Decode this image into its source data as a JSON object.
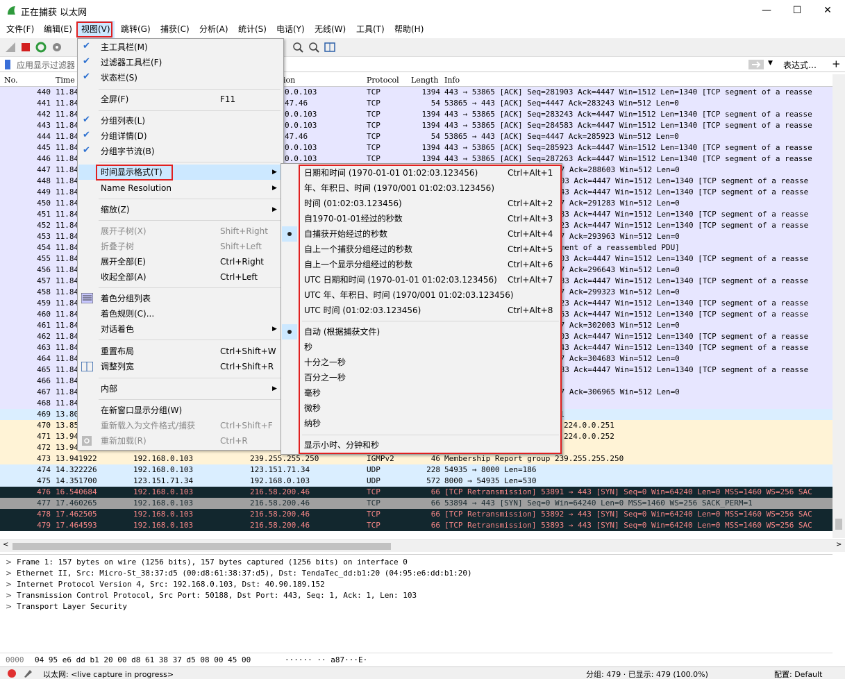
{
  "window": {
    "title": "正在捕获 以太网",
    "min": "—",
    "max": "☐",
    "close": "✕"
  },
  "menubar": [
    "文件(F)",
    "编辑(E)",
    "视图(V)",
    "跳转(G)",
    "捕获(C)",
    "分析(A)",
    "统计(S)",
    "电话(Y)",
    "无线(W)",
    "工具(T)",
    "帮助(H)"
  ],
  "filter": {
    "placeholder": "应用显示过滤器 …",
    "expr_label": "表达式…",
    "plus": "+"
  },
  "columns": {
    "no": "No.",
    "time": "Time",
    "dest_partial": "ion",
    "protocol": "Protocol",
    "length": "Length",
    "info": "Info"
  },
  "rows_top": [
    {
      "no": "440",
      "time": "11.84",
      "dst": "0.0.103",
      "proto": "TCP",
      "len": "1394",
      "info": "443 → 53865 [ACK] Seq=281903 Ack=4447 Win=1512 Len=1340 [TCP segment of a reasse"
    },
    {
      "no": "441",
      "time": "11.84",
      "dst": "47.46",
      "proto": "TCP",
      "len": "54",
      "info": "53865 → 443 [ACK] Seq=4447 Ack=283243 Win=512 Len=0"
    },
    {
      "no": "442",
      "time": "11.84",
      "dst": "0.0.103",
      "proto": "TCP",
      "len": "1394",
      "info": "443 → 53865 [ACK] Seq=283243 Ack=4447 Win=1512 Len=1340 [TCP segment of a reasse"
    },
    {
      "no": "443",
      "time": "11.84",
      "dst": "0.0.103",
      "proto": "TCP",
      "len": "1394",
      "info": "443 → 53865 [ACK] Seq=284583 Ack=4447 Win=1512 Len=1340 [TCP segment of a reasse"
    },
    {
      "no": "444",
      "time": "11.84",
      "dst": "47.46",
      "proto": "TCP",
      "len": "54",
      "info": "53865 → 443 [ACK] Seq=4447 Ack=285923 Win=512 Len=0"
    },
    {
      "no": "445",
      "time": "11.84",
      "dst": "0.0.103",
      "proto": "TCP",
      "len": "1394",
      "info": "443 → 53865 [ACK] Seq=285923 Ack=4447 Win=1512 Len=1340 [TCP segment of a reasse"
    },
    {
      "no": "446",
      "time": "11.84",
      "dst": "0.0.103",
      "proto": "TCP",
      "len": "1394",
      "info": "443 → 53865 [ACK] Seq=287263 Ack=4447 Win=1512 Len=1340 [TCP segment of a reasse"
    }
  ],
  "rows_mid_right": [
    "47 Ack=288603 Win=512 Len=0",
    "603 Ack=4447 Win=1512 Len=1340 [TCP segment of a reasse",
    "943 Ack=4447 Win=1512 Len=1340 [TCP segment of a reasse",
    "47 Ack=291283 Win=512 Len=0",
    "283 Ack=4447 Win=1512 Len=1340 [TCP segment of a reasse",
    "623 Ack=4447 Win=1512 Len=1340 [TCP segment of a reasse",
    "47 Ack=293963 Win=512 Len=0",
    "gment of a reassembled PDU]",
    "303 Ack=4447 Win=1512 Len=1340 [TCP segment of a reasse",
    "47 Ack=296643 Win=512 Len=0",
    "983 Ack=4447 Win=1512 Len=1340 [TCP segment of a reasse",
    "47 Ack=299323 Win=512 Len=0",
    "323 Ack=4447 Win=1512 Len=1340 [TCP segment of a reasse",
    "663 Ack=4447 Win=1512 Len=1340 [TCP segment of a reasse",
    "47 Ack=302003 Win=512 Len=0",
    "003 Ack=4447 Win=1512 Len=1340 [TCP segment of a reasse",
    "343 Ack=4447 Win=1512 Len=1340 [TCP segment of a reasse",
    "47 Ack=304683 Win=512 Len=0",
    "683 Ack=4447 Win=1512 Len=1340 [TCP segment of a reasse",
    "",
    "47 Ack=306965 Win=512 Len=0",
    "",
    "1",
    "224.0.0.251",
    "224.0.0.252"
  ],
  "rows_mid_left": [
    {
      "no": "447",
      "time": "11.84"
    },
    {
      "no": "448",
      "time": "11.84"
    },
    {
      "no": "449",
      "time": "11.84"
    },
    {
      "no": "450",
      "time": "11.84"
    },
    {
      "no": "451",
      "time": "11.84"
    },
    {
      "no": "452",
      "time": "11.84"
    },
    {
      "no": "453",
      "time": "11.84"
    },
    {
      "no": "454",
      "time": "11.84"
    },
    {
      "no": "455",
      "time": "11.84"
    },
    {
      "no": "456",
      "time": "11.84"
    },
    {
      "no": "457",
      "time": "11.84"
    },
    {
      "no": "458",
      "time": "11.84"
    },
    {
      "no": "459",
      "time": "11.84"
    },
    {
      "no": "460",
      "time": "11.84"
    },
    {
      "no": "461",
      "time": "11.84"
    },
    {
      "no": "462",
      "time": "11.84"
    },
    {
      "no": "463",
      "time": "11.84"
    },
    {
      "no": "464",
      "time": "11.84"
    },
    {
      "no": "465",
      "time": "11.84"
    },
    {
      "no": "466",
      "time": "11.84"
    },
    {
      "no": "467",
      "time": "11.84"
    },
    {
      "no": "468",
      "time": "11.84"
    },
    {
      "no": "469",
      "time": "13.80"
    },
    {
      "no": "470",
      "time": "13.85"
    },
    {
      "no": "471",
      "time": "13.94"
    },
    {
      "no": "472",
      "time": "13.94"
    }
  ],
  "rows_bottom": [
    {
      "no": "473",
      "time": "13.941922",
      "src": "192.168.0.103",
      "dst": "239.255.255.250",
      "proto": "IGMPv2",
      "len": "46",
      "info": "Membership Report group 239.255.255.250"
    },
    {
      "no": "474",
      "time": "14.322226",
      "src": "192.168.0.103",
      "dst": "123.151.71.34",
      "proto": "UDP",
      "len": "228",
      "info": "54935 → 8000 Len=186"
    },
    {
      "no": "475",
      "time": "14.351700",
      "src": "123.151.71.34",
      "dst": "192.168.0.103",
      "proto": "UDP",
      "len": "572",
      "info": "8000 → 54935 Len=530"
    },
    {
      "no": "476",
      "time": "16.540684",
      "src": "192.168.0.103",
      "dst": "216.58.200.46",
      "proto": "TCP",
      "len": "66",
      "info": "[TCP Retransmission] 53891 → 443 [SYN] Seq=0 Win=64240 Len=0 MSS=1460 WS=256 SAC"
    },
    {
      "no": "477",
      "time": "17.460265",
      "src": "192.168.0.103",
      "dst": "216.58.200.46",
      "proto": "TCP",
      "len": "66",
      "info": "53894 → 443 [SYN] Seq=0 Win=64240 Len=0 MSS=1460 WS=256 SACK_PERM=1"
    },
    {
      "no": "478",
      "time": "17.462505",
      "src": "192.168.0.103",
      "dst": "216.58.200.46",
      "proto": "TCP",
      "len": "66",
      "info": "[TCP Retransmission] 53892 → 443 [SYN] Seq=0 Win=64240 Len=0 MSS=1460 WS=256 SAC"
    },
    {
      "no": "479",
      "time": "17.464593",
      "src": "192.168.0.103",
      "dst": "216.58.200.46",
      "proto": "TCP",
      "len": "66",
      "info": "[TCP Retransmission] 53893 → 443 [SYN] Seq=0 Win=64240 Len=0 MSS=1460 WS=256 SAC"
    }
  ],
  "colors": {
    "tcp_row": "#e7e6ff",
    "udp_row": "#daeeff",
    "igmp_row": "#fff3d6",
    "bad_row_bg": "#12272e",
    "bad_row_fg": "#f78787",
    "gray_row_bg": "#a0a0a0",
    "highlight": "#cce8ff",
    "redbox": "#e02020"
  },
  "view_menu": {
    "main_toolbar": "主工具栏(M)",
    "filter_toolbar": "过滤器工具栏(F)",
    "status_bar": "状态栏(S)",
    "fullscreen": "全屏(F)",
    "fullscreen_key": "F11",
    "packet_list": "分组列表(L)",
    "packet_details": "分组详情(D)",
    "packet_bytes": "分组字节流(B)",
    "time_format": "时间显示格式(T)",
    "name_resolution": "Name Resolution",
    "zoom": "缩放(Z)",
    "expand_sub": "展开子树(X)",
    "expand_sub_key": "Shift+Right",
    "collapse_sub": "折叠子树",
    "collapse_sub_key": "Shift+Left",
    "expand_all": "展开全部(E)",
    "expand_all_key": "Ctrl+Right",
    "collapse_all": "收起全部(A)",
    "collapse_all_key": "Ctrl+Left",
    "colorize": "着色分组列表",
    "color_rules": "着色规则(C)...",
    "conv_color": "对话着色",
    "reset_layout": "重置布局",
    "reset_layout_key": "Ctrl+Shift+W",
    "resize_cols": "调整列宽",
    "resize_cols_key": "Ctrl+Shift+R",
    "internals": "内部",
    "new_window": "在新窗口显示分组(W)",
    "reload_as": "重新载入为文件格式/捕获",
    "reload_as_key": "Ctrl+Shift+F",
    "reload": "重新加载(R)",
    "reload_key": "Ctrl+R"
  },
  "time_menu": {
    "items": [
      {
        "label": "日期和时间 (1970-01-01 01:02:03.123456)",
        "key": "Ctrl+Alt+1"
      },
      {
        "label": "年、年积日、时间 (1970/001 01:02:03.123456)",
        "key": ""
      },
      {
        "label": "时间 (01:02:03.123456)",
        "key": "Ctrl+Alt+2"
      },
      {
        "label": "自1970-01-01经过的秒数",
        "key": "Ctrl+Alt+3"
      },
      {
        "label": "自捕获开始经过的秒数",
        "key": "Ctrl+Alt+4"
      },
      {
        "label": "自上一个捕获分组经过的秒数",
        "key": "Ctrl+Alt+5"
      },
      {
        "label": "自上一个显示分组经过的秒数",
        "key": "Ctrl+Alt+6"
      },
      {
        "label": "UTC 日期和时间 (1970-01-01 01:02:03.123456)",
        "key": "Ctrl+Alt+7"
      },
      {
        "label": "UTC 年、年积日、时间 (1970/001 01:02:03.123456)",
        "key": ""
      },
      {
        "label": "UTC 时间 (01:02:03.123456)",
        "key": "Ctrl+Alt+8"
      }
    ],
    "precision": [
      "自动 (根据捕获文件)",
      "秒",
      "十分之一秒",
      "百分之一秒",
      "毫秒",
      "微秒",
      "纳秒"
    ],
    "show_hms": "显示小时、分钟和秒"
  },
  "details": [
    "Frame 1: 157 bytes on wire (1256 bits), 157 bytes captured (1256 bits) on interface 0",
    "Ethernet II, Src: Micro-St_38:37:d5 (00:d8:61:38:37:d5), Dst: TendaTec_dd:b1:20 (04:95:e6:dd:b1:20)",
    "Internet Protocol Version 4, Src: 192.168.0.103, Dst: 40.90.189.152",
    "Transmission Control Protocol, Src Port: 50188, Dst Port: 443, Seq: 1, Ack: 1, Len: 103",
    "Transport Layer Security"
  ],
  "bytes": {
    "offset": "0000",
    "hex": "04 95 e6 dd b1 20 00 d8  61 38 37 d5 08 00 45 00",
    "ascii": "······ ·· a87···E·"
  },
  "status": {
    "iface": "以太网: <live capture in progress>",
    "packets": "分组: 479 · 已显示: 479 (100.0%)",
    "profile": "配置: Default"
  }
}
